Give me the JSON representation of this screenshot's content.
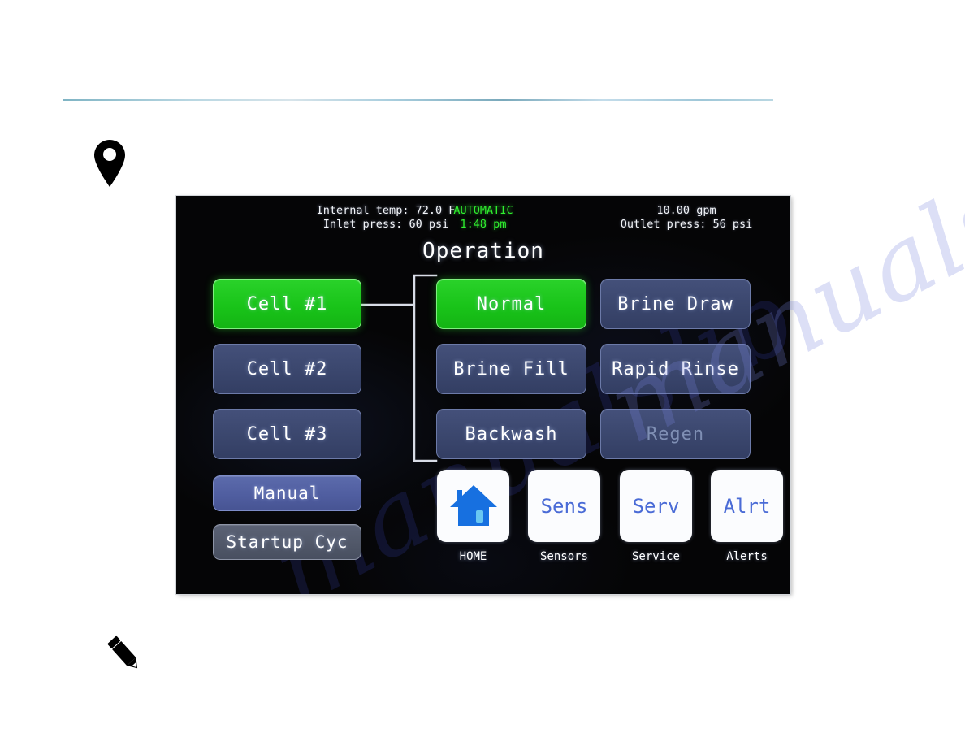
{
  "page": {
    "pin_icon": "map-pin-icon",
    "pencil_icon": "pencil-icon",
    "watermark": "manualslib.com"
  },
  "screen": {
    "title": "Operation",
    "status": {
      "left_line1": "Internal temp: 72.0 F",
      "left_line2": "Inlet press: 60 psi",
      "center_line1": "AUTOMATIC",
      "center_line2": "1:48 pm",
      "right_line1": "10.00 gpm",
      "right_line2": "Outlet press: 56 psi",
      "center_color": "#2ff12f"
    },
    "cells": [
      {
        "label": "Cell #1",
        "state": "active"
      },
      {
        "label": "Cell #2",
        "state": "normal"
      },
      {
        "label": "Cell #3",
        "state": "normal"
      }
    ],
    "modes": [
      {
        "label": "Manual",
        "state": "highlight"
      },
      {
        "label": "Startup Cyc",
        "state": "gray"
      }
    ],
    "cycles_col1": [
      {
        "label": "Normal",
        "state": "active"
      },
      {
        "label": "Brine Fill",
        "state": "normal"
      },
      {
        "label": "Backwash",
        "state": "normal"
      }
    ],
    "cycles_col2": [
      {
        "label": "Brine Draw",
        "state": "normal"
      },
      {
        "label": "Rapid Rinse",
        "state": "normal"
      },
      {
        "label": "Regen",
        "state": "disabled"
      }
    ],
    "nav": [
      {
        "icon": "home-icon",
        "glyph": "",
        "label": "HOME"
      },
      {
        "icon": "sensors-icon",
        "glyph": "Sens",
        "label": "Sensors"
      },
      {
        "icon": "service-icon",
        "glyph": "Serv",
        "label": "Service"
      },
      {
        "icon": "alerts-icon",
        "glyph": "Alrt",
        "label": "Alerts"
      }
    ],
    "colors": {
      "active_green": "#19c419",
      "button_blue": "#3b476e",
      "highlight_blue": "#505ea0",
      "nav_text_blue": "#4a6bd6",
      "disabled_text": "#7f8fb4"
    }
  }
}
